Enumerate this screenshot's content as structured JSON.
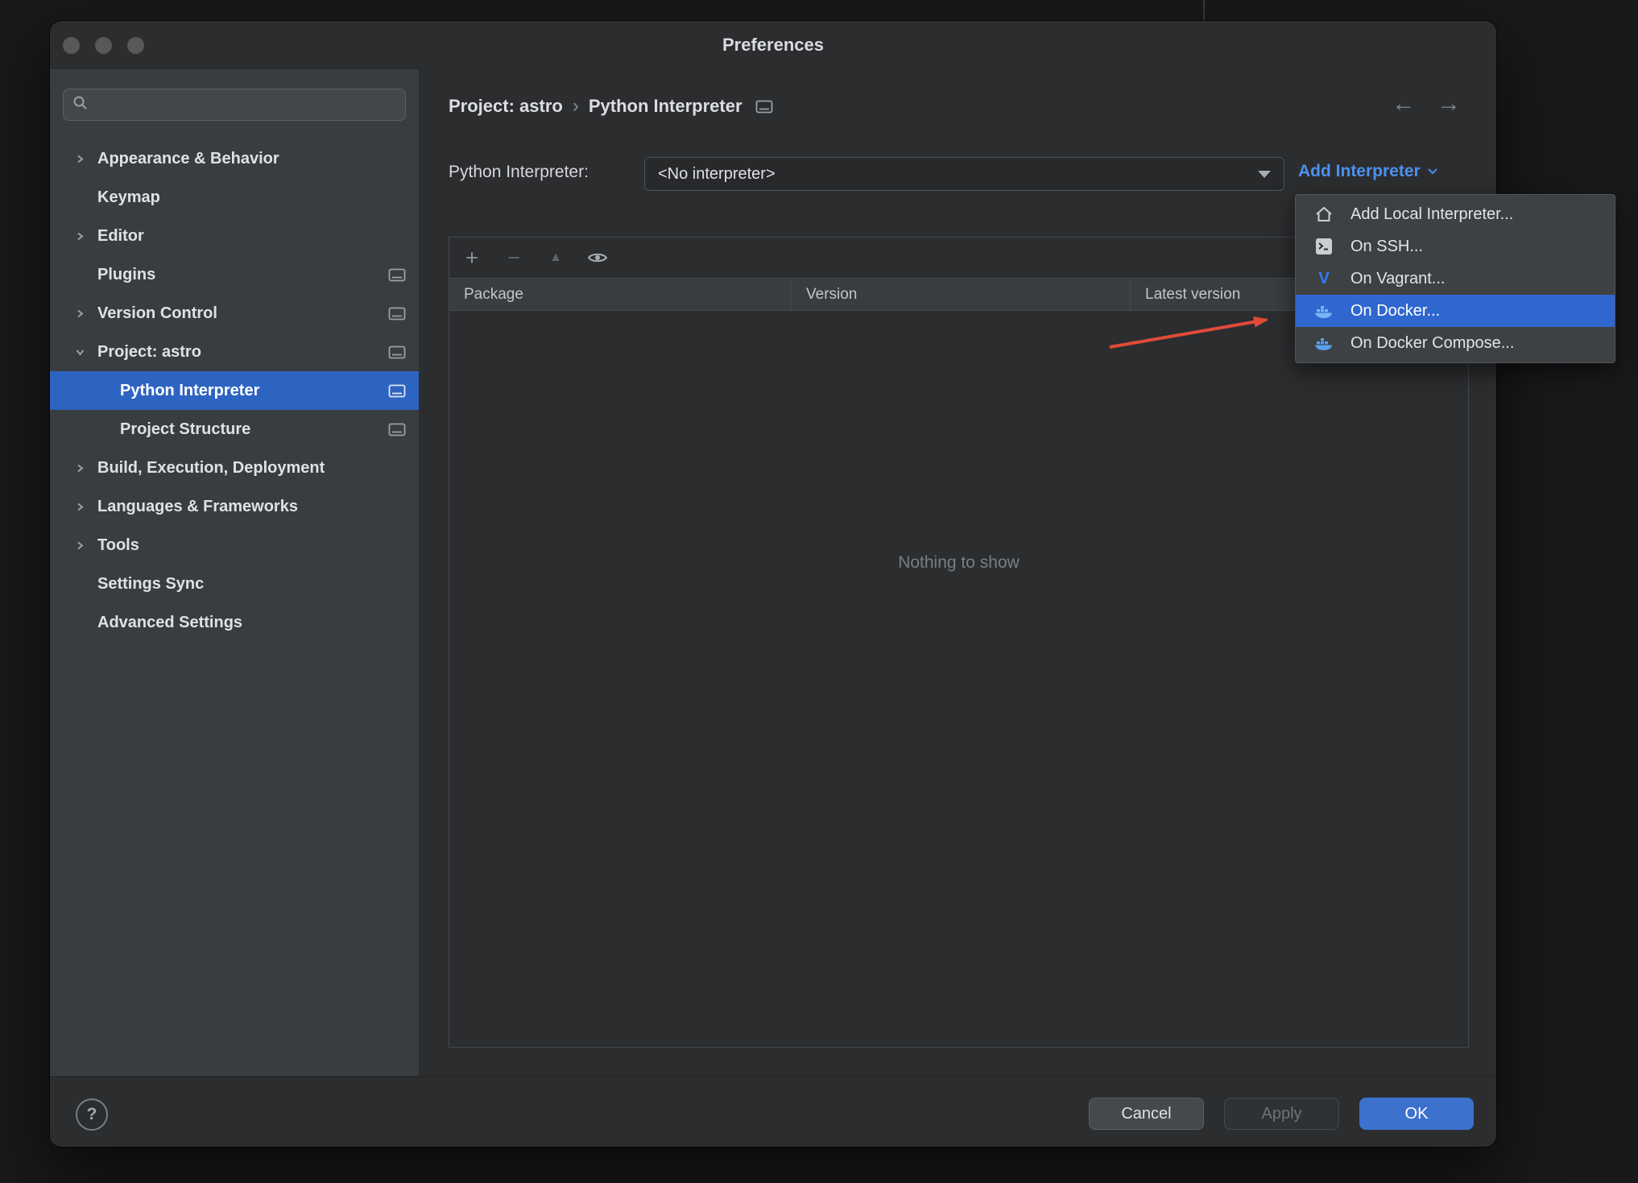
{
  "colors": {
    "selection_blue": "#2e64c1",
    "menu_selection_blue": "#2f67cf",
    "link_blue": "#4b91f1",
    "ok_button_blue": "#3c72cd",
    "annotation_arrow_red": "#e14b38"
  },
  "window": {
    "title": "Preferences"
  },
  "sidebar": {
    "search": {
      "placeholder": ""
    },
    "items": [
      {
        "label": "Appearance & Behavior"
      },
      {
        "label": "Keymap"
      },
      {
        "label": "Editor"
      },
      {
        "label": "Plugins"
      },
      {
        "label": "Version Control"
      },
      {
        "label": "Project: astro"
      },
      {
        "label": "Python Interpreter"
      },
      {
        "label": "Project Structure"
      },
      {
        "label": "Build, Execution, Deployment"
      },
      {
        "label": "Languages & Frameworks"
      },
      {
        "label": "Tools"
      },
      {
        "label": "Settings Sync"
      },
      {
        "label": "Advanced Settings"
      }
    ]
  },
  "breadcrumb": {
    "project": "Project: astro",
    "separator": "›",
    "page": "Python Interpreter"
  },
  "interpreter_row": {
    "label": "Python Interpreter:",
    "value": "<No interpreter>",
    "add_link": "Add Interpreter"
  },
  "add_menu": {
    "items": [
      {
        "label": "Add Local Interpreter...",
        "icon": "home-icon"
      },
      {
        "label": "On SSH...",
        "icon": "ssh-terminal-icon"
      },
      {
        "label": "On Vagrant...",
        "icon": "vagrant-icon"
      },
      {
        "label": "On Docker...",
        "icon": "docker-icon",
        "selected": true
      },
      {
        "label": "On Docker Compose...",
        "icon": "docker-icon"
      }
    ]
  },
  "packages": {
    "columns": [
      "Package",
      "Version",
      "Latest version"
    ],
    "empty_text": "Nothing to show",
    "toolbar_icons": [
      "add-icon",
      "remove-icon",
      "upgrade-icon",
      "eye-icon"
    ]
  },
  "footer": {
    "help": "?",
    "cancel": "Cancel",
    "apply": "Apply",
    "ok": "OK"
  }
}
